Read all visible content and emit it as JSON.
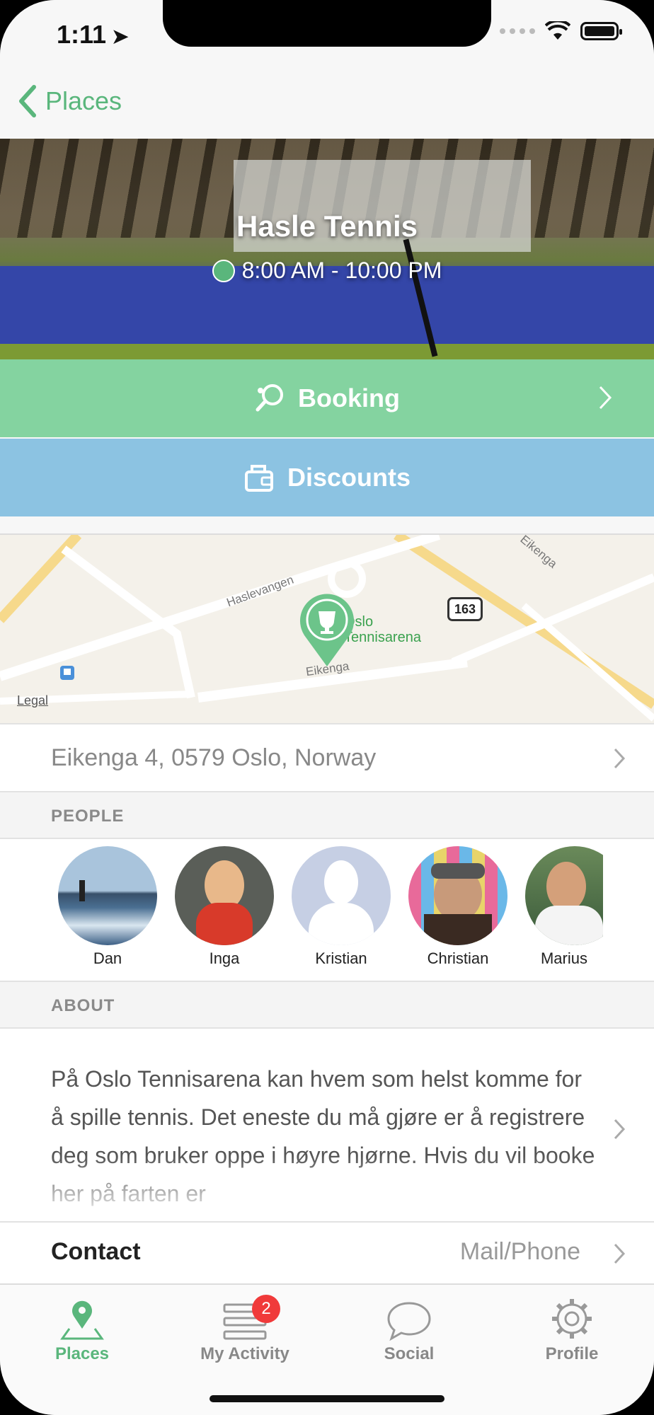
{
  "status_bar": {
    "time": "1:11"
  },
  "nav": {
    "back_label": "Places"
  },
  "hero": {
    "title": "Hasle Tennis",
    "hours": "8:00 AM - 10:00 PM"
  },
  "actions": {
    "booking": "Booking",
    "discounts": "Discounts"
  },
  "map": {
    "legal": "Legal",
    "place_label_line1": "Oslo",
    "place_label_line2": "Tennisarena",
    "route_badge": "163",
    "roads": [
      "Haslevangen",
      "Eikenga",
      "Eikenga"
    ]
  },
  "address": "Eikenga 4, 0579 Oslo, Norway",
  "people": {
    "header": "PEOPLE",
    "items": [
      {
        "name": "Dan"
      },
      {
        "name": "Inga"
      },
      {
        "name": "Kristian"
      },
      {
        "name": "Christian"
      },
      {
        "name": "Marius"
      }
    ]
  },
  "about": {
    "header": "ABOUT",
    "text": "På Oslo Tennisarena kan hvem som helst komme for å spille tennis. Det eneste du må gjøre er å registrere deg som bruker oppe i høyre hjørne. Hvis du vil booke her på farten er"
  },
  "contact": {
    "label": "Contact",
    "value": "Mail/Phone"
  },
  "tabbar": {
    "tabs": [
      {
        "label": "Places",
        "active": true
      },
      {
        "label": "My Activity",
        "badge": "2"
      },
      {
        "label": "Social"
      },
      {
        "label": "Profile"
      }
    ]
  },
  "colors": {
    "accent": "#5ab67c",
    "booking": "#84d3a0",
    "discounts": "#8cc3e2",
    "badge": "#f03a3a"
  }
}
